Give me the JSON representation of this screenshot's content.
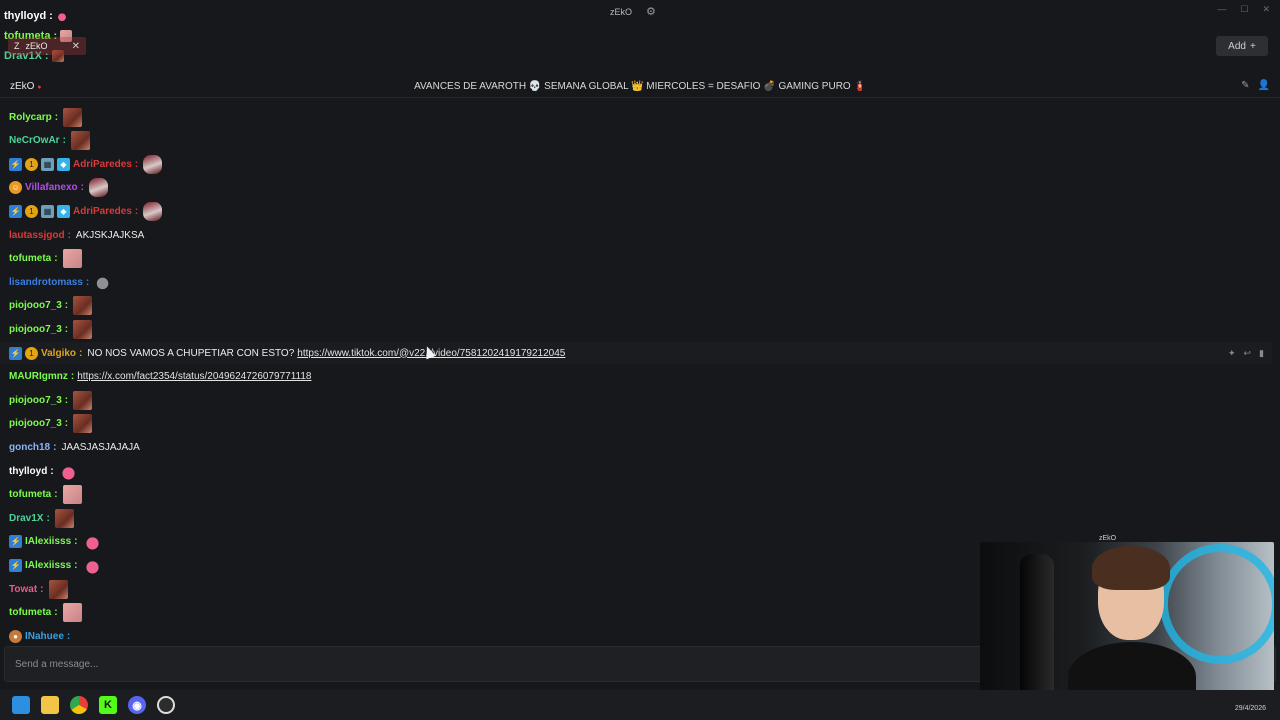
{
  "window": {
    "title": "zEkO"
  },
  "overlay_chat": [
    {
      "user": "thylloyd",
      "color": "#ffffff",
      "emote": "heart"
    },
    {
      "user": "tofumeta",
      "color": "#7cfc4e",
      "emote": "pink"
    },
    {
      "user": "Drav1X",
      "color": "#4ed39a",
      "emote": "face"
    }
  ],
  "tabs": [
    {
      "label": "zEkO"
    }
  ],
  "add_button": {
    "label": "Add"
  },
  "channel": {
    "name": "zEkO",
    "stream_title": "AVANCES DE AVAROTH 💀 SEMANA GLOBAL 👑 MIERCOLES = DESAFIO 💣 GAMING PURO 🧯"
  },
  "messages": [
    {
      "user": "Rolycarp",
      "color": "#7cfc4e",
      "badges": [],
      "text": "",
      "emote": "face"
    },
    {
      "user": "NeCrOwAr",
      "color": "#4ed39a",
      "badges": [],
      "text": "",
      "emote": "face"
    },
    {
      "user": "AdriParedes",
      "color": "#d93a3a",
      "badges": [
        "blue",
        "gold",
        "grid",
        "cube"
      ],
      "text": "",
      "emote": "can"
    },
    {
      "user": "Villafanexo",
      "color": "#b24ee8",
      "badges": [
        "orange"
      ],
      "text": "",
      "emote": "can"
    },
    {
      "user": "AdriParedes",
      "color": "#d93a3a",
      "badges": [
        "blue",
        "gold",
        "grid",
        "cube"
      ],
      "text": "",
      "emote": "can"
    },
    {
      "user": "lautassjgod",
      "color": "#d93a3a",
      "badges": [],
      "text": "AKJSKJAJKSA",
      "emote": ""
    },
    {
      "user": "tofumeta",
      "color": "#7cfc4e",
      "badges": [],
      "text": "",
      "emote": "pink"
    },
    {
      "user": "lisandrotomass",
      "color": "#3a7fe0",
      "badges": [],
      "text": "",
      "emote": "mouse"
    },
    {
      "user": "piojooo7_3",
      "color": "#7cfc4e",
      "badges": [],
      "text": "",
      "emote": "face"
    },
    {
      "user": "piojooo7_3",
      "color": "#7cfc4e",
      "badges": [],
      "text": "",
      "emote": "face"
    },
    {
      "user": "Valgiko",
      "color": "#e0a41c",
      "badges": [
        "blue",
        "gold"
      ],
      "text": "NO NOS VAMOS A CHUPETIAR CON ESTO?",
      "link": "https://www.tiktok.com/@v22.i/video/7581202419179212045",
      "emote": "",
      "highlight": true
    },
    {
      "user": "MAURIgmnz",
      "color": "#7cfc4e",
      "badges": [],
      "text": "",
      "link": "https://x.com/fact2354/status/2049624726079771118",
      "emote": ""
    },
    {
      "user": "piojooo7_3",
      "color": "#7cfc4e",
      "badges": [],
      "text": "",
      "emote": "face"
    },
    {
      "user": "piojooo7_3",
      "color": "#7cfc4e",
      "badges": [],
      "text": "",
      "emote": "face"
    },
    {
      "user": "gonch18",
      "color": "#8ab4f8",
      "badges": [],
      "text": "JAASJASJAJAJA",
      "emote": ""
    },
    {
      "user": "thylloyd",
      "color": "#ffffff",
      "badges": [],
      "text": "",
      "emote": "heart"
    },
    {
      "user": "tofumeta",
      "color": "#7cfc4e",
      "badges": [],
      "text": "",
      "emote": "pink"
    },
    {
      "user": "Drav1X",
      "color": "#4ed39a",
      "badges": [],
      "text": "",
      "emote": "face"
    },
    {
      "user": "IAlexiisss",
      "color": "#7cfc4e",
      "badges": [
        "blue"
      ],
      "text": "",
      "emote": "heart"
    },
    {
      "user": "IAlexiisss",
      "color": "#7cfc4e",
      "badges": [
        "blue"
      ],
      "text": "",
      "emote": "heart"
    },
    {
      "user": "Towat",
      "color": "#e85a8a",
      "badges": [],
      "text": "",
      "emote": "face"
    },
    {
      "user": "tofumeta",
      "color": "#7cfc4e",
      "badges": [],
      "text": "",
      "emote": "pink"
    },
    {
      "user": "INahuee",
      "color": "#3a9fe0",
      "badges": [
        "bear"
      ],
      "text": "",
      "emote": ""
    }
  ],
  "input": {
    "placeholder": "Send a message..."
  },
  "webcam": {
    "label": "zEkO"
  },
  "taskbar": {
    "date": "29/4/2026"
  }
}
